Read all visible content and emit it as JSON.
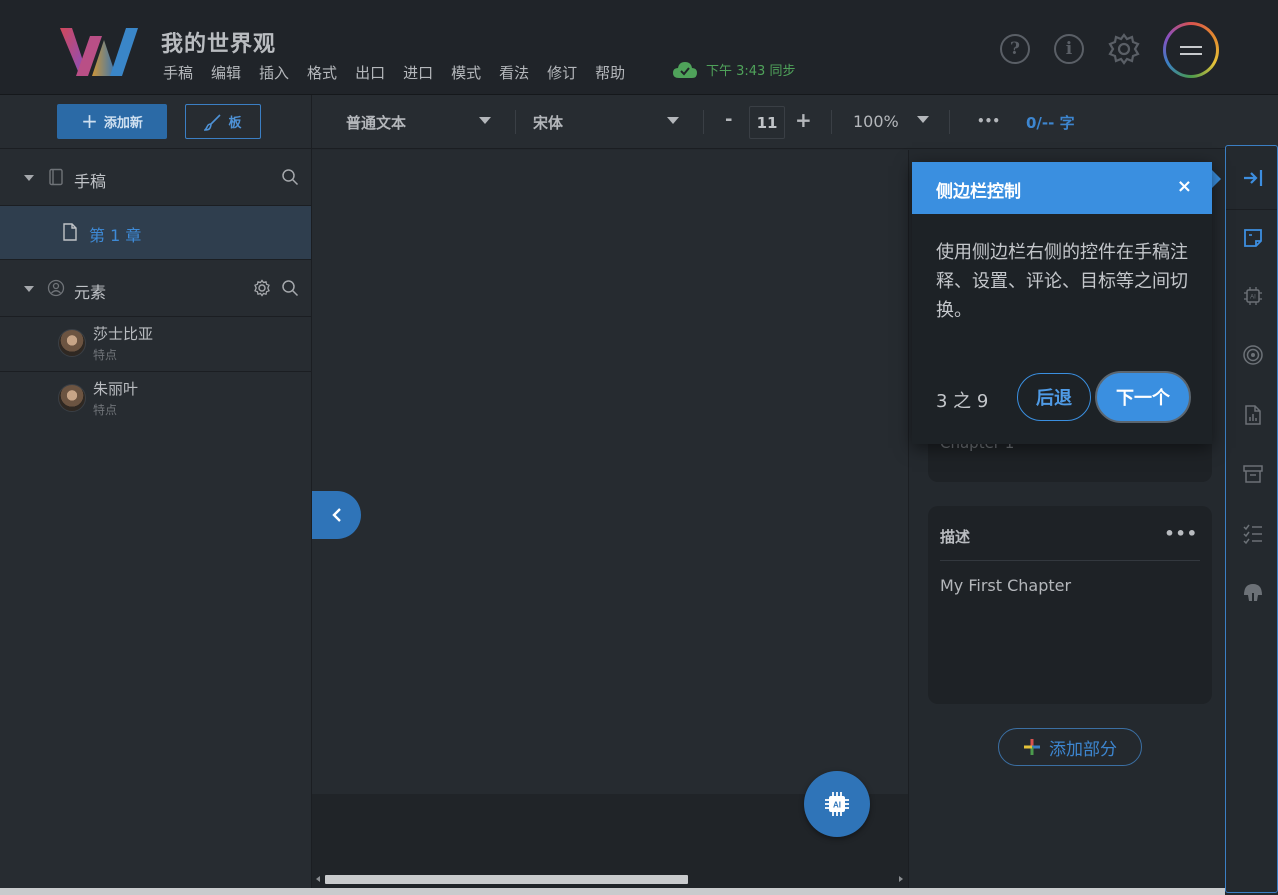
{
  "header": {
    "title": "我的世界观",
    "menu": [
      "手稿",
      "编辑",
      "插入",
      "格式",
      "出口",
      "进口",
      "模式",
      "看法",
      "修订",
      "帮助"
    ],
    "sync_status": "下午 3:43 同步",
    "help_icon": "question-circle-icon",
    "info_icon": "info-circle-icon",
    "settings_icon": "gear-icon",
    "colors": {
      "sync": "#4fa25a",
      "accent": "#3a8fe0"
    }
  },
  "left": {
    "add_new": "添加新",
    "board": "板",
    "manuscript_label": "手稿",
    "chapter_label": "第 1 章",
    "elements_label": "元素",
    "characters": [
      {
        "name": "莎士比亚",
        "type": "特点"
      },
      {
        "name": "朱丽叶",
        "type": "特点"
      }
    ]
  },
  "toolbar": {
    "paragraph_style": "普通文本",
    "font": "宋体",
    "minus": "-",
    "font_size": "11",
    "plus": "+",
    "zoom": "100%",
    "more": "•••",
    "word_count": "0/-- 字"
  },
  "right": {
    "chapter_card_text": "Chapter 1",
    "desc_title": "描述",
    "desc_more": "•••",
    "desc_body": "My First Chapter",
    "add_section": "添加部分"
  },
  "tooltip": {
    "title": "侧边栏控制",
    "close": "×",
    "body": "使用侧边栏右侧的控件在手稿注释、设置、评论、目标等之间切换。",
    "counter": "3 之 9",
    "back": "后退",
    "next": "下一个"
  }
}
